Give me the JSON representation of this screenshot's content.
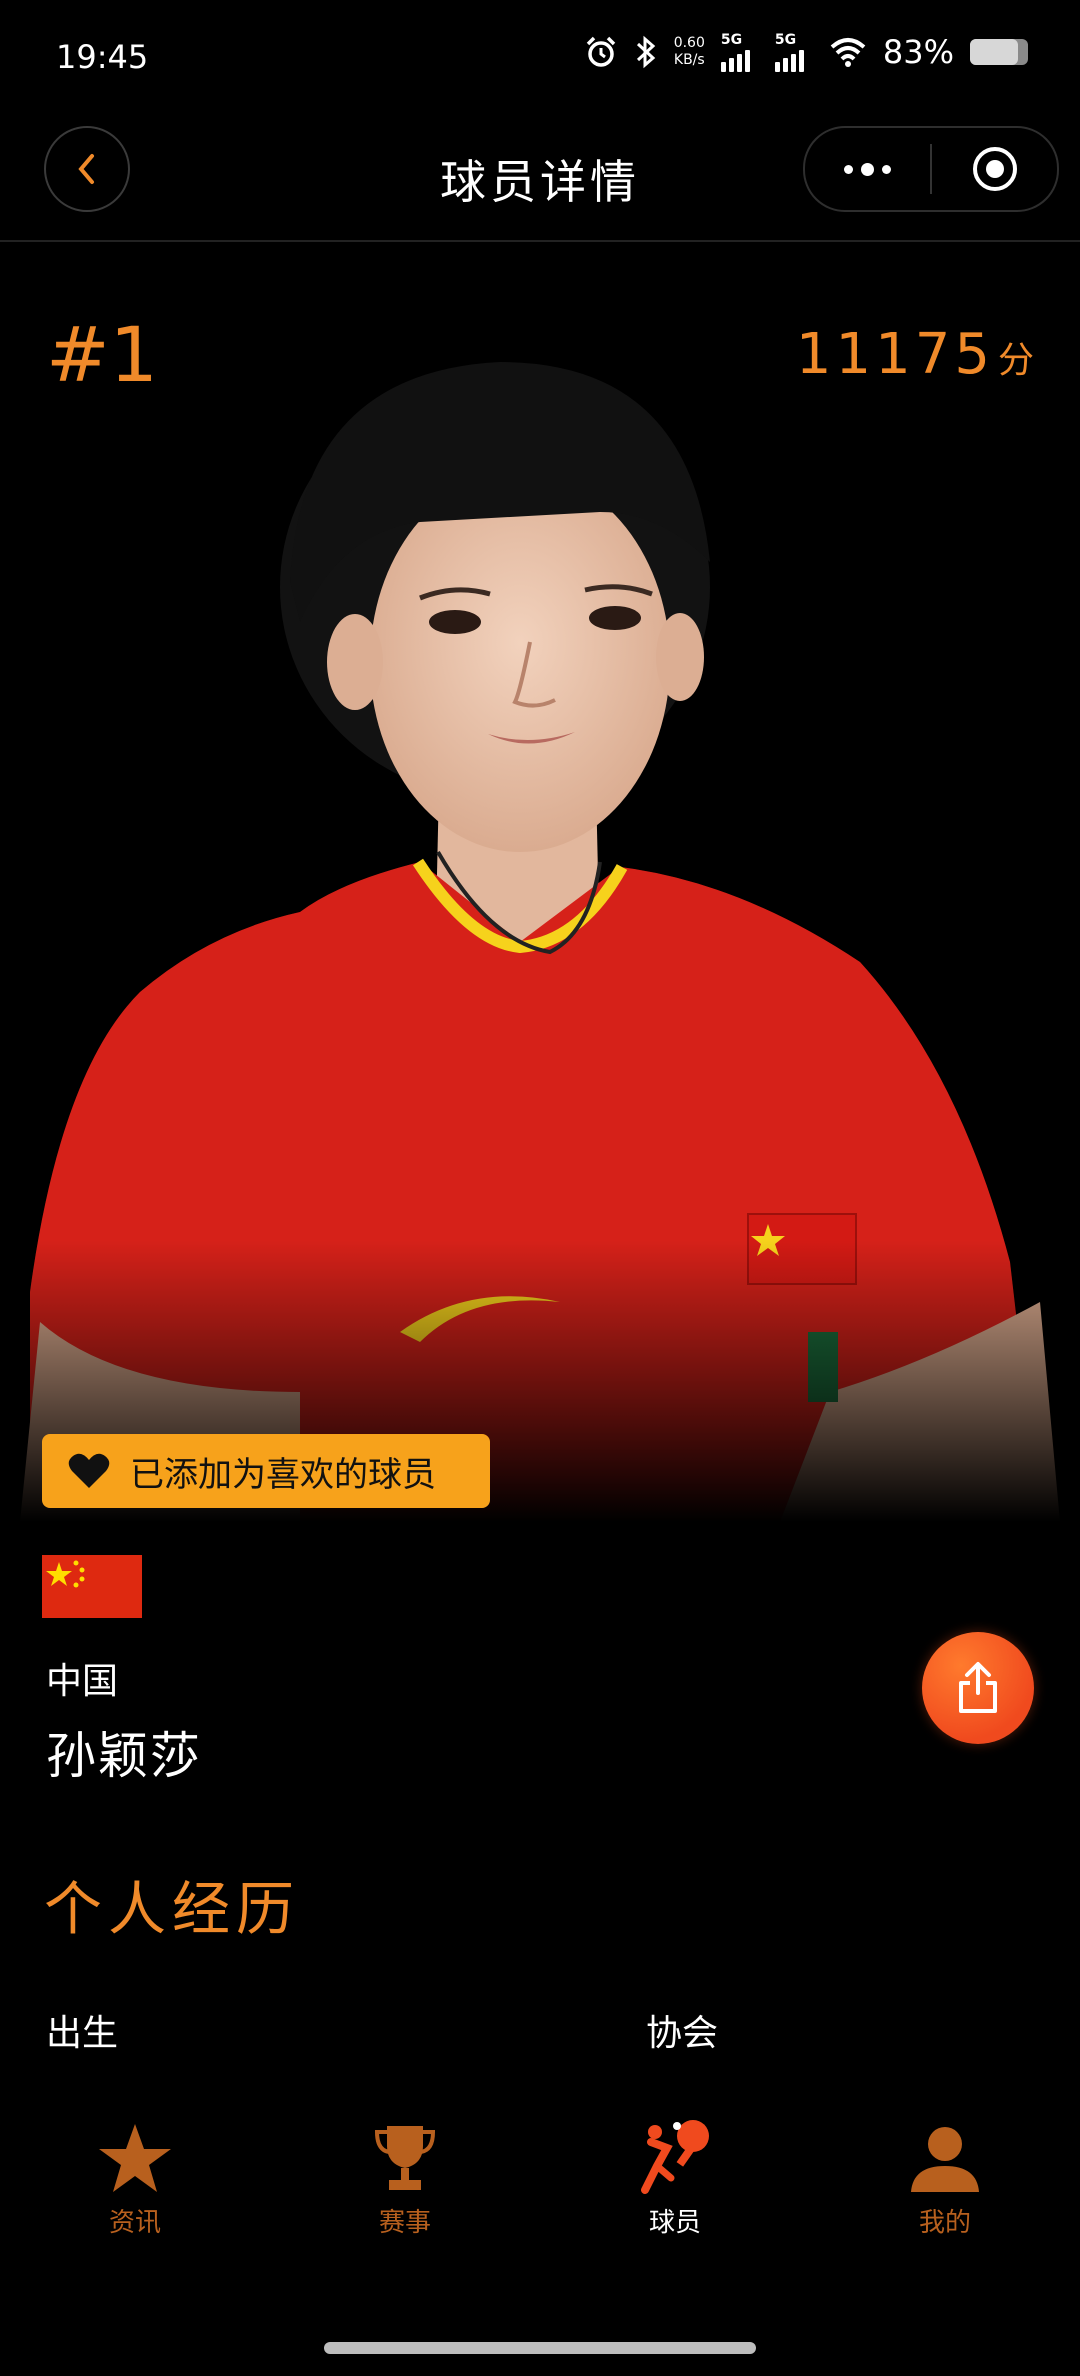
{
  "status_bar": {
    "time": "19:45",
    "net_speed_value": "0.60",
    "net_speed_unit": "KB/s",
    "signal1_label": "5G",
    "signal2_label": "5G",
    "battery_pct": "83%",
    "battery_level": 0.83
  },
  "nav": {
    "title": "球员详情",
    "back_icon": "chevron-left-icon",
    "more_icon": "more-dots-icon",
    "close_icon": "target-circle-icon"
  },
  "player": {
    "rank": "#1",
    "score": "11175",
    "score_unit": "分",
    "favorite_label": "已添加为喜欢的球员",
    "country": "中国",
    "name": "孙颖莎"
  },
  "profile": {
    "section_title": "个人经历",
    "birth_label": "出生",
    "association_label": "协会"
  },
  "tabs": [
    {
      "label": "资讯",
      "icon": "star-icon",
      "active": false
    },
    {
      "label": "赛事",
      "icon": "trophy-icon",
      "active": false
    },
    {
      "label": "球员",
      "icon": "ping-pong-player-icon",
      "active": true
    },
    {
      "label": "我的",
      "icon": "person-icon",
      "active": false
    }
  ],
  "colors": {
    "accent": "#f08a2a",
    "badge": "#f7a21b",
    "share_button": "#f04a1e",
    "tab_inactive": "#b8601e"
  }
}
